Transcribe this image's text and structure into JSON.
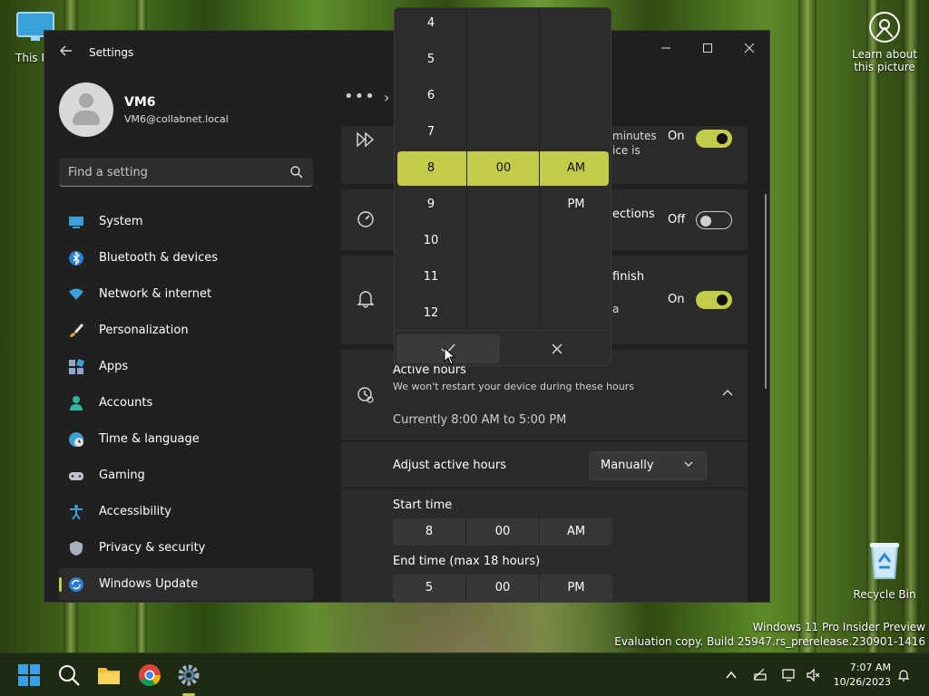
{
  "desktop": {
    "this_pc_label": "This PC",
    "recycle_bin_label": "Recycle Bin",
    "learn_about": "Learn about this picture",
    "watermark": {
      "line1": "Windows 11 Pro Insider Preview",
      "line2": "Evaluation copy. Build 25947.rs_prerelease.230901-1416"
    }
  },
  "window": {
    "title": "Settings"
  },
  "profile": {
    "name": "VM6",
    "email": "VM6@collabnet.local"
  },
  "search": {
    "placeholder": "Find a setting"
  },
  "sidebar": {
    "items": [
      {
        "label": "System",
        "icon": "system-icon"
      },
      {
        "label": "Bluetooth & devices",
        "icon": "bluetooth-icon"
      },
      {
        "label": "Network & internet",
        "icon": "network-icon"
      },
      {
        "label": "Personalization",
        "icon": "brush-icon"
      },
      {
        "label": "Apps",
        "icon": "apps-icon"
      },
      {
        "label": "Accounts",
        "icon": "accounts-icon"
      },
      {
        "label": "Time & language",
        "icon": "time-language-icon"
      },
      {
        "label": "Gaming",
        "icon": "gaming-icon"
      },
      {
        "label": "Accessibility",
        "icon": "accessibility-icon"
      },
      {
        "label": "Privacy & security",
        "icon": "shield-icon"
      },
      {
        "label": "Windows Update",
        "icon": "windows-update-icon",
        "active": true
      }
    ]
  },
  "cards": {
    "get_latest": {
      "text_line1": "minutes",
      "text_line2": "ice is",
      "toggle_label": "On",
      "toggle_state": "on"
    },
    "metered": {
      "text": "ections",
      "toggle_label": "Off",
      "toggle_state": "off"
    },
    "notify": {
      "text_line1": "finish",
      "text_line2": "a",
      "toggle_label": "On",
      "toggle_state": "on"
    }
  },
  "active_hours": {
    "title": "Active hours",
    "description": "We won't restart your device during these hours",
    "current": "Currently 8:00 AM to 5:00 PM",
    "adjust_label": "Adjust active hours",
    "adjust_value": "Manually",
    "start_label": "Start time",
    "start": {
      "hour": "8",
      "minute": "00",
      "period": "AM"
    },
    "end_label": "End time (max 18 hours)",
    "end": {
      "hour": "5",
      "minute": "00",
      "period": "PM"
    }
  },
  "flyout": {
    "hours": [
      "4",
      "5",
      "6",
      "7",
      "8",
      "9",
      "10",
      "11",
      "12"
    ],
    "minute": "00",
    "periods": [
      "AM",
      "PM"
    ],
    "confirm_icon": "checkmark-icon",
    "cancel_icon": "close-icon"
  },
  "taskbar": {
    "time": "7:07 AM",
    "date": "10/26/2023"
  },
  "colors": {
    "accent": "#c2cc4a",
    "window_bg": "#202020",
    "card_bg": "#2b2b2b"
  }
}
